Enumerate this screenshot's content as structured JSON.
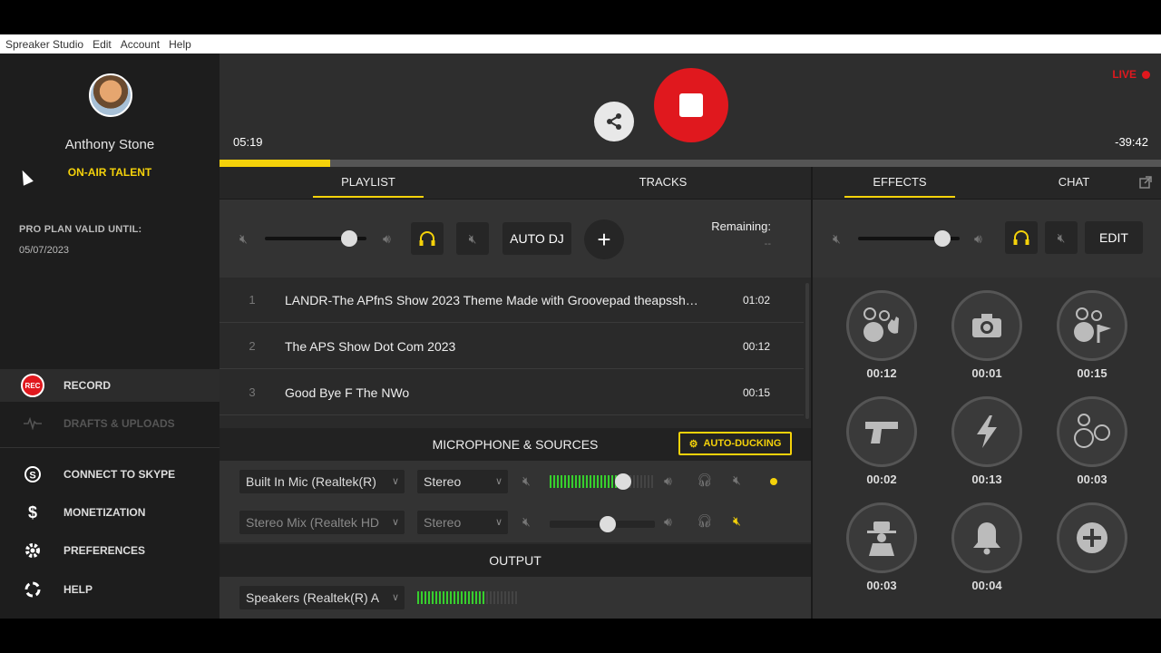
{
  "menu": [
    "Spreaker Studio",
    "Edit",
    "Account",
    "Help"
  ],
  "user": {
    "name": "Anthony Stone",
    "role": "ON-AIR TALENT"
  },
  "plan": {
    "label": "PRO PLAN VALID UNTIL:",
    "date": "05/07/2023"
  },
  "nav": {
    "record": {
      "badge": "REC",
      "label": "RECORD"
    },
    "drafts": "DRAFTS & UPLOADS",
    "skype": "CONNECT TO SKYPE",
    "monetization": "MONETIZATION",
    "preferences": "PREFERENCES",
    "help": "HELP"
  },
  "header": {
    "live": "LIVE",
    "elapsed": "05:19",
    "remaining": "-39:42",
    "progress_fraction": 0.118
  },
  "tabs": {
    "playlist": "PLAYLIST",
    "tracks": "TRACKS",
    "effects": "EFFECTS",
    "chat": "CHAT"
  },
  "playlist_controls": {
    "auto_dj": "AUTO DJ",
    "remaining_label": "Remaining:",
    "remaining_value": "--",
    "volume": 0.83
  },
  "playlist": [
    {
      "num": "1",
      "title": "LANDR-The APfnS Show 2023 Theme Made with Groovepad theapssh…",
      "duration": "01:02"
    },
    {
      "num": "2",
      "title": "The APS Show Dot Com 2023",
      "duration": "00:12"
    },
    {
      "num": "3",
      "title": "Good Bye F The NWo",
      "duration": "00:15"
    }
  ],
  "mic": {
    "title": "MICROPHONE & SOURCES",
    "ducking": "AUTO-DUCKING",
    "sources": [
      {
        "device": "Built In Mic (Realtek(R)",
        "mode": "Stereo"
      },
      {
        "device": "Stereo Mix (Realtek HD",
        "mode": "Stereo"
      }
    ]
  },
  "output": {
    "title": "OUTPUT",
    "device": "Speakers (Realtek(R) A"
  },
  "effects_controls": {
    "edit": "EDIT",
    "volume": 0.83
  },
  "effects": [
    {
      "icon": "faces-wave-icon",
      "time": "00:12"
    },
    {
      "icon": "camera-icon",
      "time": "00:01"
    },
    {
      "icon": "faces-flag-icon",
      "time": "00:15"
    },
    {
      "icon": "gun-icon",
      "time": "00:02"
    },
    {
      "icon": "lightning-icon",
      "time": "00:13"
    },
    {
      "icon": "faces-icon",
      "time": "00:03"
    },
    {
      "icon": "spy-icon",
      "time": "00:03"
    },
    {
      "icon": "bell-icon",
      "time": "00:04"
    },
    {
      "icon": "add-effect-icon",
      "time": ""
    }
  ],
  "colors": {
    "accent": "#f5d20a",
    "record_red": "#e0181e",
    "meter_green": "#37d02d"
  }
}
